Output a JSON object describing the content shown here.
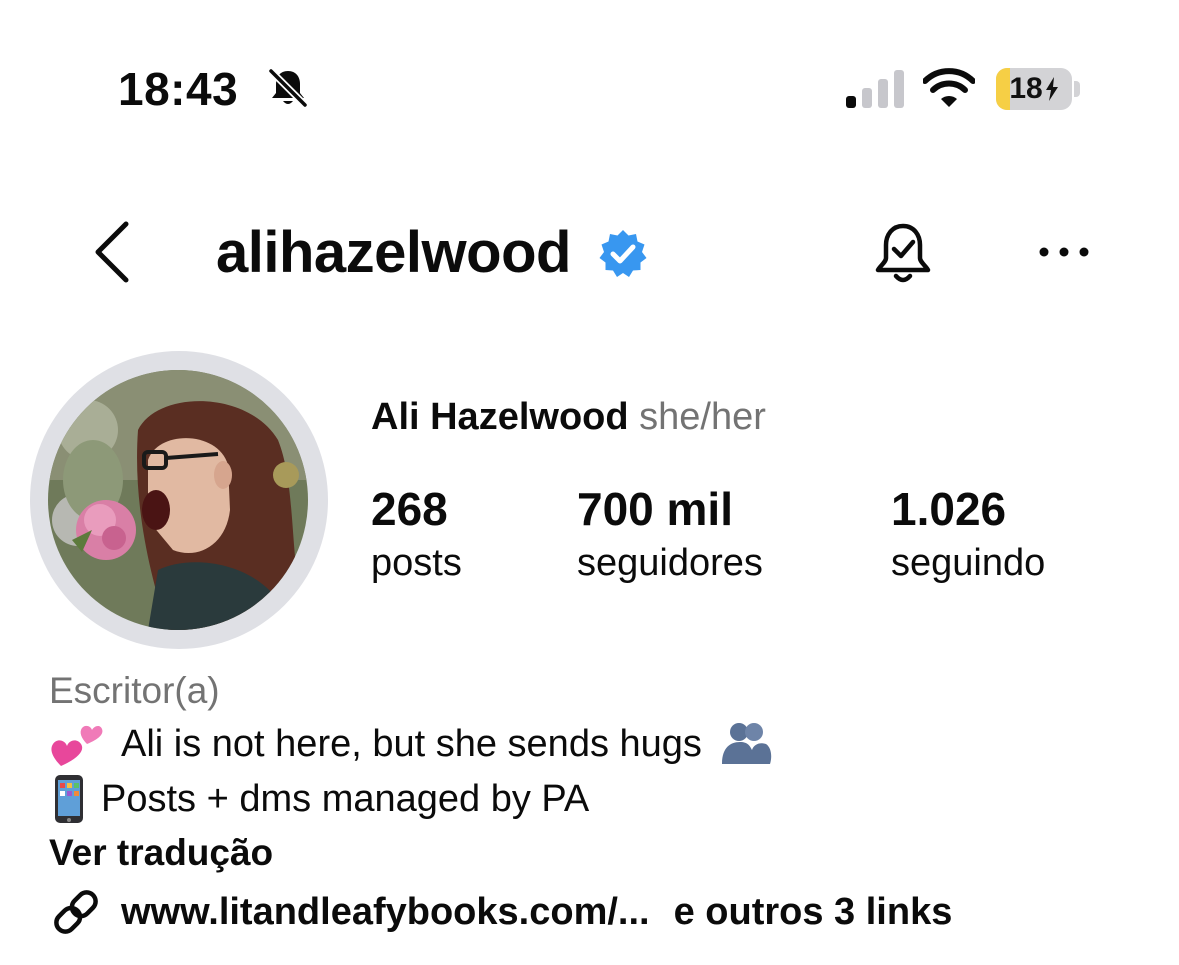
{
  "status_bar": {
    "time": "18:43",
    "battery_label": "18",
    "battery_level": 0.18,
    "icons": [
      "bell-slash-icon",
      "cellular-signal-icon",
      "wifi-icon",
      "battery-charging-icon"
    ]
  },
  "header": {
    "username": "alihazelwood",
    "icons": [
      "chevron-left-icon",
      "verified-badge-icon",
      "bell-check-icon",
      "more-horizontal-icon"
    ]
  },
  "profile": {
    "name": "Ali Hazelwood",
    "pronouns": "she/her",
    "stats": {
      "posts": {
        "value": "268",
        "label": "posts"
      },
      "followers": {
        "value": "700 mil",
        "label": "seguidores"
      },
      "following": {
        "value": "1.026",
        "label": "seguindo"
      }
    }
  },
  "bio": {
    "category": "Escritor(a)",
    "line1_text": "Ali is not here, but she sends hugs",
    "line2_text": "Posts + dms managed by PA",
    "line1_emojis": [
      "two-hearts-emoji",
      "people-hugging-emoji"
    ],
    "line2_emojis": [
      "mobile-phone-emoji"
    ],
    "translate_label": "Ver tradução",
    "link_url": "www.litandleafybooks.com/...",
    "more_links": "e outros 3 links"
  },
  "colors": {
    "text": "#0b0b0b",
    "secondary_text": "#737373",
    "verified_blue": "#3897f0",
    "avatar_ring": "#dfe0e5",
    "battery_fill": "#f6cf45"
  }
}
